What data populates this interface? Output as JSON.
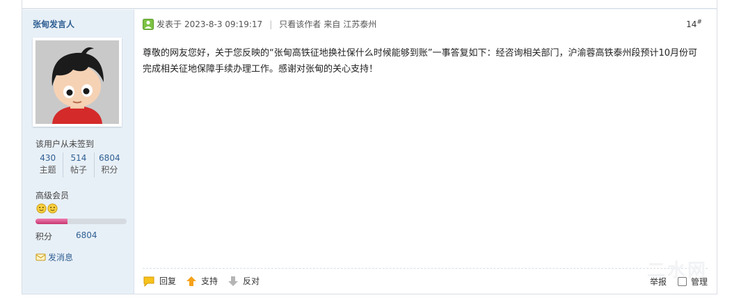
{
  "post": {
    "author": "张甸发言人",
    "signin_text": "该用户从未签到",
    "stats": [
      {
        "value": "430",
        "label": "主题"
      },
      {
        "value": "514",
        "label": "帖子"
      },
      {
        "value": "6804",
        "label": "积分"
      }
    ],
    "group": "高级会员",
    "points_label": "积分",
    "points_value": "6804",
    "points_progress": 0.35,
    "send_message": "发消息",
    "meta": {
      "posted_prefix": "发表于",
      "datetime": "2023-8-3 09:19:17",
      "author_only": "只看该作者",
      "from_label": "来自",
      "location": "江苏泰州"
    },
    "floor": "14",
    "floor_mark": "#",
    "content": "尊敬的网友您好，关于您反映的“张甸高铁征地换社保什么时候能够到账”一事答复如下：经咨询相关部门，沪渝蓉高铁泰州段预计10月份可完成相关征地保障手续办理工作。感谢对张甸的关心支持！"
  },
  "actions": {
    "reply": "回复",
    "support": "支持",
    "oppose": "反对",
    "report": "举报",
    "manage": "管理"
  },
  "watermark": "二水网",
  "colors": {
    "link": "#2f5f93",
    "sidebar_bg": "#e8f0f7",
    "progress": "#e0559a"
  }
}
